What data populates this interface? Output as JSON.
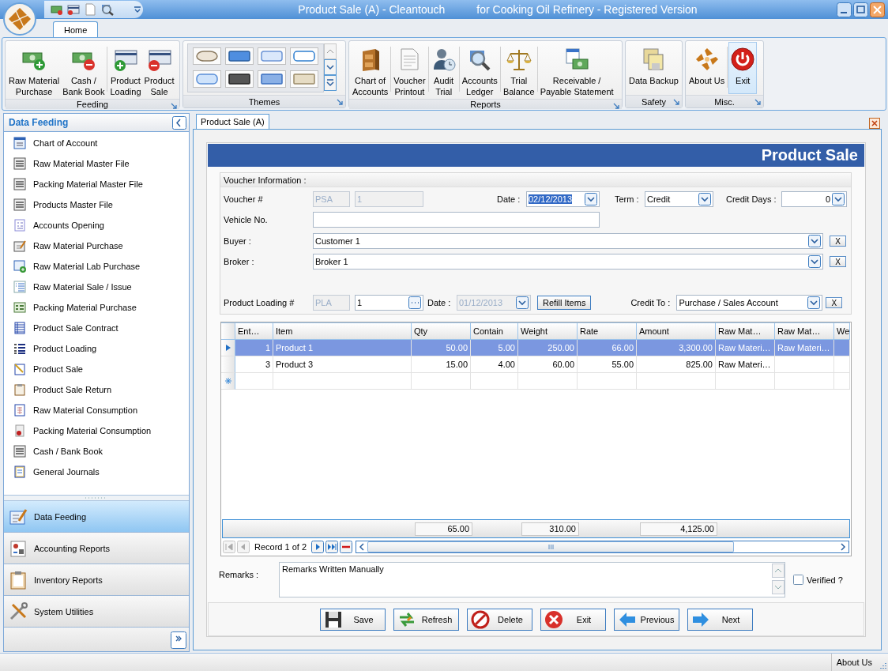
{
  "window": {
    "title": "Product Sale (A) - Cleantouch",
    "title_suffix": "for Cooking Oil Refinery - Registered Version"
  },
  "ribbon": {
    "tabs": [
      {
        "label": "Home",
        "selected": true
      }
    ],
    "groups": [
      {
        "label": "Feeding",
        "kind": "buttons",
        "items": [
          {
            "label": "Raw Material\nPurchase",
            "highlighted": false
          },
          {
            "label": "Cash /\nBank Book",
            "highlighted": false
          },
          {
            "label": "Product\nLoading",
            "highlighted": false
          },
          {
            "label": "Product\nSale",
            "highlighted": false
          }
        ]
      },
      {
        "label": "Themes",
        "kind": "gallery"
      },
      {
        "label": "Reports",
        "kind": "buttons",
        "items": [
          {
            "label": "Chart of\nAccounts",
            "highlighted": false
          },
          {
            "label": "Voucher\nPrintout",
            "highlighted": false
          },
          {
            "label": "Audit\nTrial",
            "highlighted": false
          },
          {
            "label": "Accounts\nLedger",
            "highlighted": false
          },
          {
            "label": "Trial\nBalance",
            "highlighted": false
          },
          {
            "label": "Receivable /\nPayable Statement",
            "highlighted": false
          }
        ]
      },
      {
        "label": "Safety",
        "kind": "buttons",
        "items": [
          {
            "label": "Data Backup",
            "highlighted": false
          }
        ]
      },
      {
        "label": "Misc.",
        "kind": "buttons",
        "items": [
          {
            "label": "About Us",
            "highlighted": false
          },
          {
            "label": "Exit",
            "highlighted": true
          }
        ]
      }
    ]
  },
  "sidebar": {
    "title": "Data Feeding",
    "items": [
      "Chart of Account",
      "Raw Material Master File",
      "Packing Material Master File",
      "Products Master File",
      "Accounts Opening",
      "Raw Material Purchase",
      "Raw Material Lab Purchase",
      "Raw Material Sale / Issue",
      "Packing Material Purchase",
      "Product Sale Contract",
      "Product Loading",
      "Product Sale",
      "Product Sale Return",
      "Raw Material Consumption",
      "Packing Material Consumption",
      "Cash / Bank Book",
      "General Journals"
    ],
    "nav": [
      {
        "label": "Data Feeding",
        "selected": true
      },
      {
        "label": "Accounting Reports",
        "selected": false
      },
      {
        "label": "Inventory Reports",
        "selected": false
      },
      {
        "label": "System Utilities",
        "selected": false
      }
    ]
  },
  "document_tabs": [
    {
      "label": "Product Sale (A)",
      "selected": true
    }
  ],
  "form": {
    "title": "Product Sale",
    "group_title": "Voucher Information :",
    "voucher": {
      "label": "Voucher #",
      "prefix": {
        "value": "PSA",
        "disabled": true
      },
      "number": {
        "value": "1",
        "disabled": true
      }
    },
    "date": {
      "label": "Date :",
      "value": "02/12/2013",
      "text_selected": true
    },
    "term": {
      "label": "Term :",
      "value": "Credit"
    },
    "credit_days": {
      "label": "Credit Days :",
      "value": "0"
    },
    "vehicle": {
      "label": "Vehicle No."
    },
    "buyer": {
      "label": "Buyer :",
      "value": "Customer 1",
      "clear_button": "X"
    },
    "broker": {
      "label": "Broker :",
      "value": "Broker 1",
      "clear_button": "X"
    },
    "loading": {
      "label": "Product Loading #",
      "prefix": {
        "value": "PLA",
        "disabled": true
      },
      "number": {
        "value": "1",
        "disabled": false
      }
    },
    "loading_date": {
      "label": "Date :",
      "value": "01/12/2013",
      "disabled": true
    },
    "refill_button": "Refill Items",
    "credit_to": {
      "label": "Credit To :",
      "value": "Purchase / Sales Account",
      "clear_button": "X"
    },
    "grid": {
      "columns": [
        "Ent…",
        "Item",
        "Qty",
        "Contain",
        "Weight",
        "Rate",
        "Amount",
        "Raw Mat…",
        "Raw Mat…",
        "We"
      ],
      "rows": [
        {
          "cells": [
            "1",
            "Product 1",
            "50.00",
            "5.00",
            "250.00",
            "66.00",
            "3,300.00",
            "Raw Materi…",
            "Raw Materi…"
          ],
          "selected": true
        },
        {
          "cells": [
            "3",
            "Product 3",
            "15.00",
            "4.00",
            "60.00",
            "55.00",
            "825.00",
            "Raw Materi…"
          ],
          "selected": false
        }
      ],
      "totals": {
        "qty": "65.00",
        "weight": "310.00",
        "amount": "4,125.00"
      },
      "record": "Record 1 of 2"
    },
    "remarks": {
      "label": "Remarks :",
      "value": "Remarks Written Manually"
    },
    "verified": {
      "label": "Verified ?",
      "checked": false
    },
    "buttons": [
      "Save",
      "Refresh",
      "Delete",
      "Exit",
      "Previous",
      "Next"
    ]
  },
  "status_bar": {
    "items": [
      "About Us"
    ]
  }
}
